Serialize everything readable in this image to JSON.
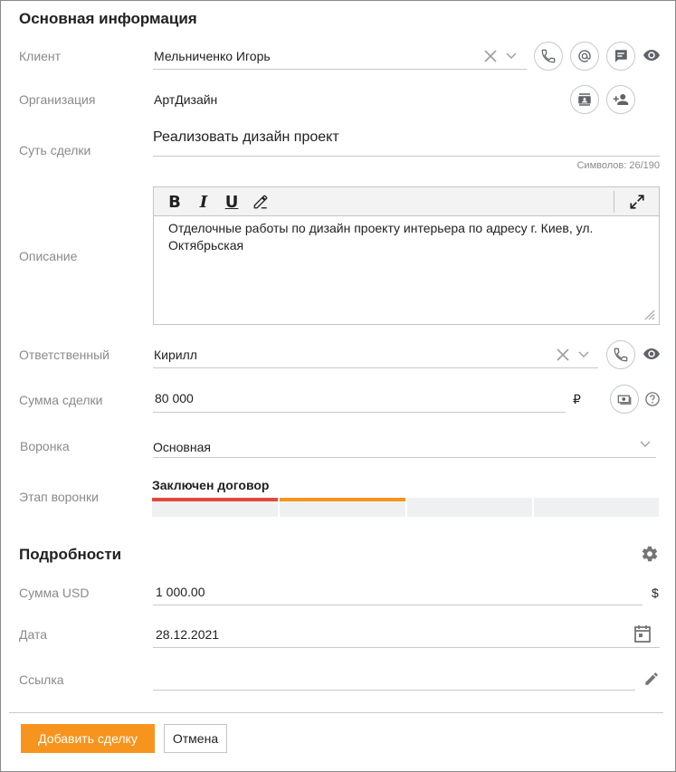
{
  "sections": {
    "main_title": "Основная информация",
    "details_title": "Подробности"
  },
  "client": {
    "label": "Клиент",
    "value": "Мельниченко Игорь"
  },
  "organization": {
    "label": "Организация",
    "value": "АртДизайн"
  },
  "deal_essence": {
    "label": "Суть сделки",
    "value": "Реализовать дизайн проект",
    "counter": "Символов: 26/190"
  },
  "description": {
    "label": "Описание",
    "text": "Отделочные работы по дизайн проекту интерьера по адресу г. Киев, ул. Октябрьская"
  },
  "responsible": {
    "label": "Ответственный",
    "value": "Кирилл"
  },
  "amount": {
    "label": "Сумма сделки",
    "value": "80 000",
    "currency": "₽"
  },
  "funnel": {
    "label": "Воронка",
    "value": "Основная"
  },
  "stage": {
    "label": "Этап воронки",
    "value": "Заключен договор",
    "colors": [
      "#e04a3a",
      "#f7941d"
    ]
  },
  "usd": {
    "label": "Сумма USD",
    "value": "1 000.00",
    "currency": "$"
  },
  "date": {
    "label": "Дата",
    "value": "28.12.2021"
  },
  "link": {
    "label": "Ссылка",
    "value": ""
  },
  "buttons": {
    "add": "Добавить сделку",
    "cancel": "Отмена"
  }
}
